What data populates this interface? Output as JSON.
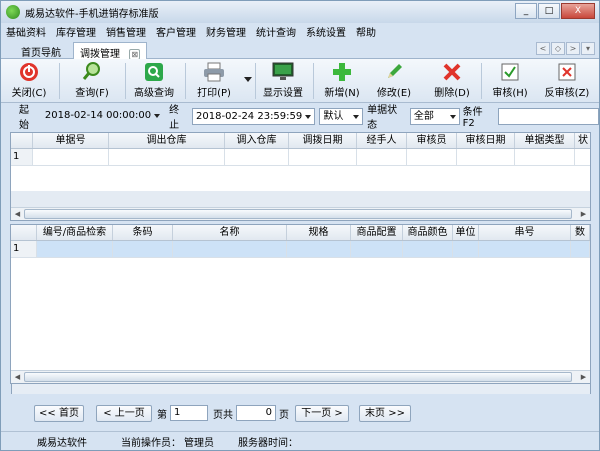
{
  "window": {
    "title": "威易达软件-手机进销存标准版",
    "controls": [
      "_",
      "□",
      "X"
    ]
  },
  "menu": [
    "基础资料",
    "库存管理",
    "销售管理",
    "客户管理",
    "财务管理",
    "统计查询",
    "系统设置",
    "帮助"
  ],
  "tabs": {
    "home": "首页导航",
    "active": "调拨管理",
    "close_glyph": "⊠",
    "nav": [
      "<",
      "◇",
      ">",
      "▾"
    ]
  },
  "toolbar": {
    "close": "关闭(C)",
    "query": "查询(F)",
    "advanced_query": "高级查询",
    "print": "打印(P)",
    "display_settings": "显示设置",
    "add": "新增(N)",
    "edit": "修改(E)",
    "delete": "删除(D)",
    "approve": "审核(H)",
    "unapprove": "反审核(Z)"
  },
  "filters": {
    "start_label": "起始",
    "start_value": "2018-02-14 00:00:00",
    "end_label": "终止",
    "end_value": "2018-02-24 23:59:59",
    "mode_value": "默认",
    "status_label": "单据状态",
    "status_value": "全部",
    "condition_label": "条件F2",
    "condition_value": ""
  },
  "top_grid": {
    "columns": [
      "",
      "单据号",
      "调出仓库",
      "调入仓库",
      "调拨日期",
      "经手人",
      "审核员",
      "审核日期",
      "单据类型",
      "状"
    ],
    "rows": [
      [
        "1",
        "",
        "",
        "",
        "",
        "",
        "",
        "",
        "",
        ""
      ]
    ]
  },
  "bottom_grid": {
    "columns": [
      "",
      "编号/商品检索",
      "条码",
      "名称",
      "规格",
      "商品配置",
      "商品颜色",
      "单位",
      "串号",
      "数"
    ],
    "rows": [
      [
        "1",
        "",
        "",
        "",
        "",
        "",
        "",
        "",
        "",
        ""
      ]
    ]
  },
  "pager": {
    "first": "<< 首页",
    "prev": "< 上一页",
    "page_label": "第",
    "page_value": "1",
    "total_label": "页共",
    "total_value": "0",
    "unit": "页",
    "next": "下一页 >",
    "last": "末页 >>"
  },
  "status": {
    "company": "威易达软件",
    "operator_label": "当前操作员：",
    "operator": "管理员",
    "server_time_label": "服务器时间："
  }
}
